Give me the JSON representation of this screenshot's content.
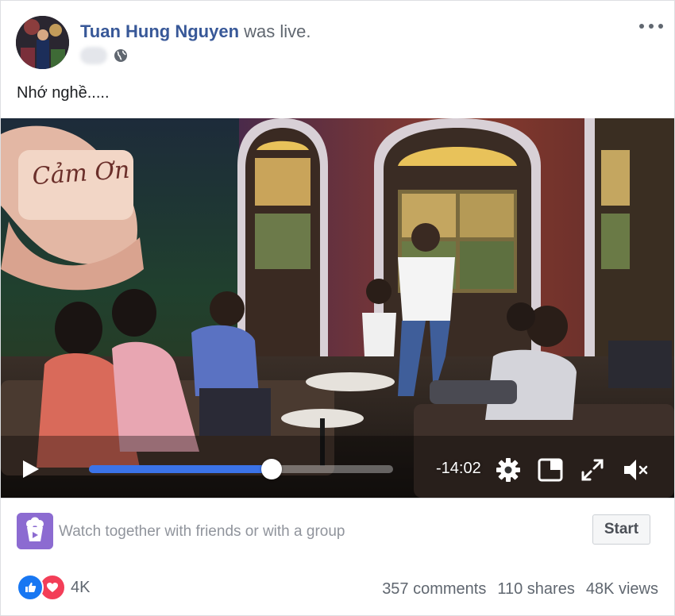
{
  "post": {
    "author": "Tuan Hung Nguyen",
    "action": "was live.",
    "privacy_icon": "globe-icon",
    "caption": "Nhớ nghề....."
  },
  "video": {
    "mural_text": "Cảm Ơn",
    "time_remaining": "-14:02",
    "progress": 0.6,
    "icons": [
      "play-icon",
      "settings-icon",
      "popout-icon",
      "fullscreen-icon",
      "mute-icon"
    ]
  },
  "watch_together": {
    "text": "Watch together with friends or with a group",
    "button": "Start"
  },
  "engagement": {
    "reaction_count": "4K",
    "comments": "357 comments",
    "shares": "110 shares",
    "views": "48K views"
  },
  "colors": {
    "author": "#385898",
    "progress": "#3b73e8",
    "watch_icon_bg": "#8c6bd1",
    "like": "#1877f2",
    "love": "#f33e58"
  }
}
